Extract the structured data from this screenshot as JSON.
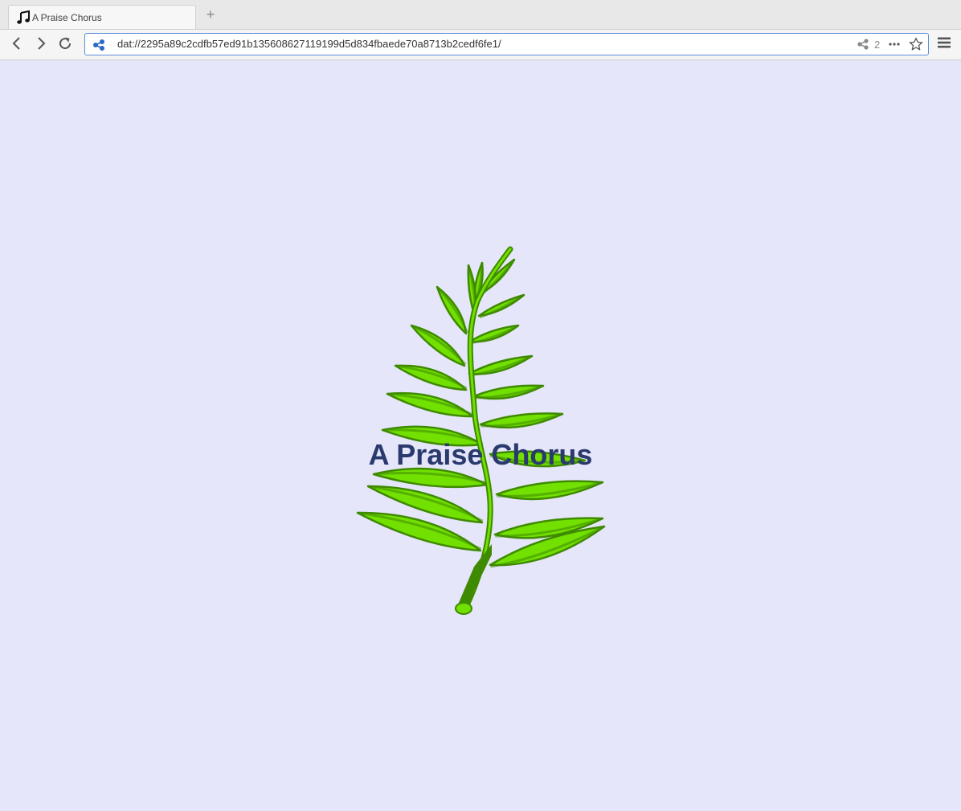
{
  "browser": {
    "tab": {
      "title": "A Praise Chorus",
      "favicon": "music-note-icon"
    },
    "new_tab_label": "+",
    "url": "dat://2295a89c2cdfb57ed91b135608627119199d5d834fbaede70a8713b2cedf6fe1/",
    "peer_count": "2",
    "accent": "#2c68c8"
  },
  "page": {
    "heading": "A Praise Chorus",
    "background": "#e5e6f9",
    "heading_color": "#2a3a6e",
    "illustration": "fern-leaf-image"
  }
}
